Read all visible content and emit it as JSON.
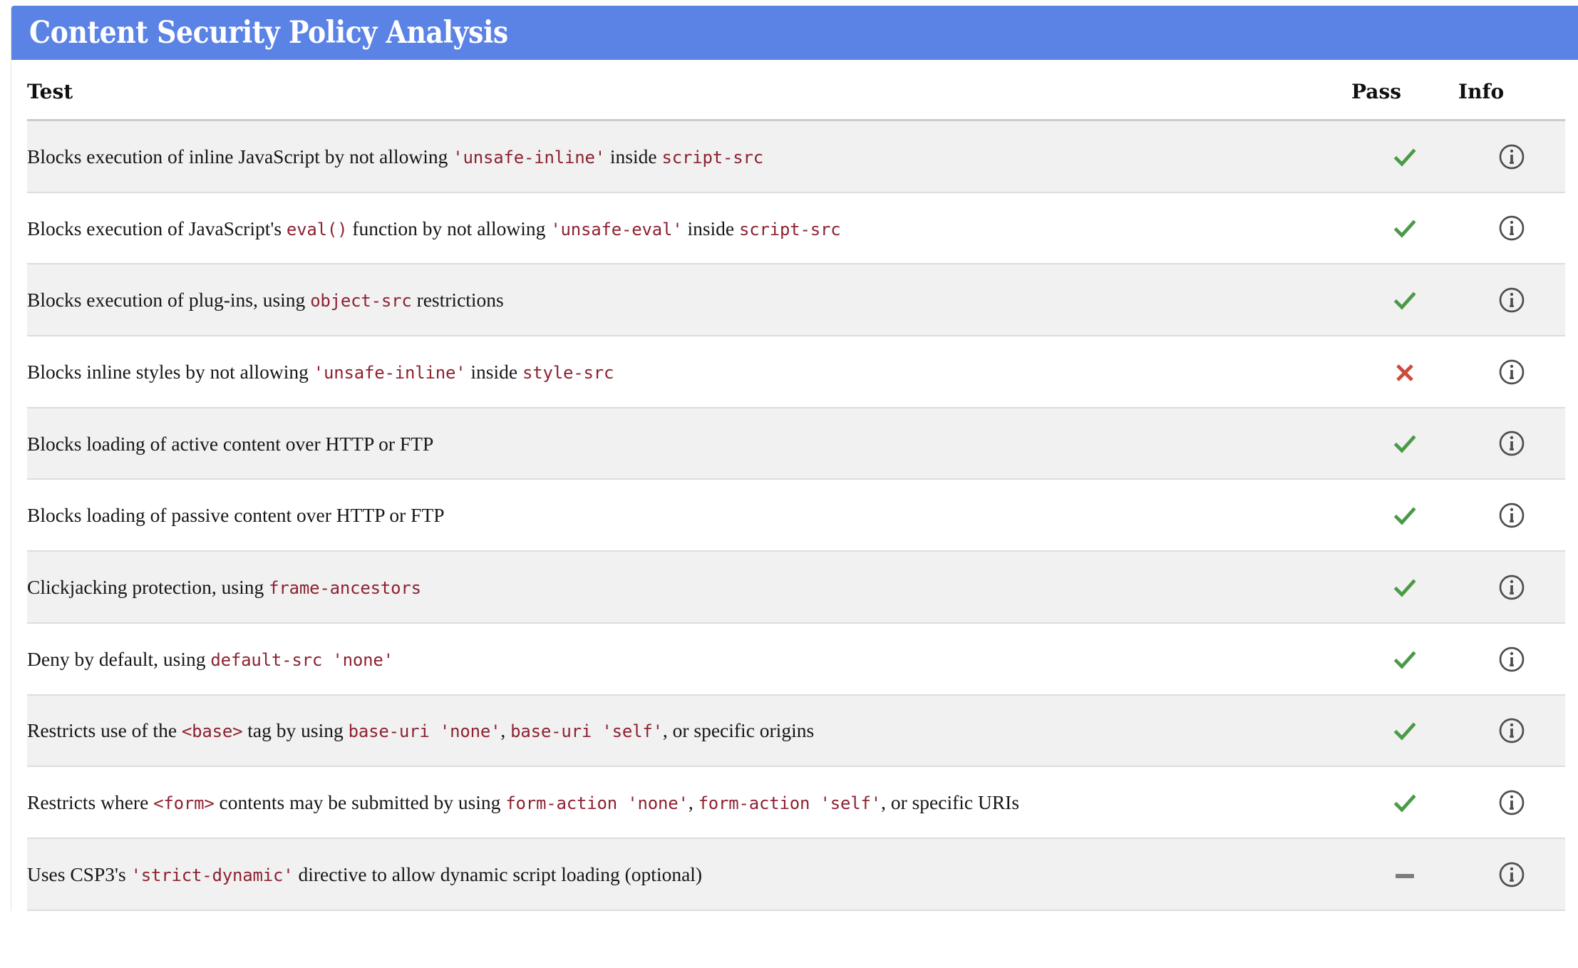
{
  "header": {
    "title": "Content Security Policy Analysis",
    "background_color": "#5b83e5",
    "text_color": "#ffffff"
  },
  "table": {
    "columns": {
      "test": "Test",
      "pass": "Pass",
      "info": "Info"
    },
    "colors": {
      "pass_green": "#4a9a48",
      "fail_red": "#cc4b3b",
      "na_gray": "#7d7d7d",
      "code_maroon": "#8d2231",
      "stripe": "#f1f1f1"
    },
    "info_icon_label": "info-icon",
    "rows": [
      {
        "id": "inline-javascript",
        "parts": [
          {
            "t": "text",
            "v": "Blocks execution of inline JavaScript by not allowing "
          },
          {
            "t": "code",
            "v": "'unsafe-inline'"
          },
          {
            "t": "text",
            "v": " inside "
          },
          {
            "t": "code",
            "v": "script-src"
          }
        ],
        "plain": "Blocks execution of inline JavaScript by not allowing 'unsafe-inline' inside script-src",
        "status": "pass"
      },
      {
        "id": "eval-function",
        "parts": [
          {
            "t": "text",
            "v": "Blocks execution of JavaScript's "
          },
          {
            "t": "code",
            "v": "eval()"
          },
          {
            "t": "text",
            "v": " function by not allowing "
          },
          {
            "t": "code",
            "v": "'unsafe-eval'"
          },
          {
            "t": "text",
            "v": " inside "
          },
          {
            "t": "code",
            "v": "script-src"
          }
        ],
        "plain": "Blocks execution of JavaScript's eval() function by not allowing 'unsafe-eval' inside script-src",
        "status": "pass"
      },
      {
        "id": "plug-ins",
        "parts": [
          {
            "t": "text",
            "v": "Blocks execution of plug-ins, using "
          },
          {
            "t": "code",
            "v": "object-src"
          },
          {
            "t": "text",
            "v": " restrictions"
          }
        ],
        "plain": "Blocks execution of plug-ins, using object-src restrictions",
        "status": "pass"
      },
      {
        "id": "inline-styles",
        "parts": [
          {
            "t": "text",
            "v": "Blocks inline styles by not allowing "
          },
          {
            "t": "code",
            "v": "'unsafe-inline'"
          },
          {
            "t": "text",
            "v": " inside "
          },
          {
            "t": "code",
            "v": "style-src"
          }
        ],
        "plain": "Blocks inline styles by not allowing 'unsafe-inline' inside style-src",
        "status": "fail"
      },
      {
        "id": "active-content",
        "parts": [
          {
            "t": "text",
            "v": "Blocks loading of active content over HTTP or FTP"
          }
        ],
        "plain": "Blocks loading of active content over HTTP or FTP",
        "status": "pass"
      },
      {
        "id": "passive-content",
        "parts": [
          {
            "t": "text",
            "v": "Blocks loading of passive content over HTTP or FTP"
          }
        ],
        "plain": "Blocks loading of passive content over HTTP or FTP",
        "status": "pass"
      },
      {
        "id": "clickjacking",
        "parts": [
          {
            "t": "text",
            "v": "Clickjacking protection, using "
          },
          {
            "t": "code",
            "v": "frame-ancestors"
          }
        ],
        "plain": "Clickjacking protection, using frame-ancestors",
        "status": "pass"
      },
      {
        "id": "deny-by-default",
        "parts": [
          {
            "t": "text",
            "v": "Deny by default, using "
          },
          {
            "t": "code",
            "v": "default-src 'none'"
          }
        ],
        "plain": "Deny by default, using default-src 'none'",
        "status": "pass"
      },
      {
        "id": "base-uri",
        "parts": [
          {
            "t": "text",
            "v": "Restricts use of the "
          },
          {
            "t": "code",
            "v": "<base>"
          },
          {
            "t": "text",
            "v": " tag by using "
          },
          {
            "t": "code",
            "v": "base-uri 'none'"
          },
          {
            "t": "text",
            "v": ", "
          },
          {
            "t": "code",
            "v": "base-uri 'self'"
          },
          {
            "t": "text",
            "v": ", or specific origins"
          }
        ],
        "plain": "Restricts use of the <base> tag by using base-uri 'none', base-uri 'self', or specific origins",
        "status": "pass"
      },
      {
        "id": "form-action",
        "parts": [
          {
            "t": "text",
            "v": "Restricts where "
          },
          {
            "t": "code",
            "v": "<form>"
          },
          {
            "t": "text",
            "v": " contents may be submitted by using "
          },
          {
            "t": "code",
            "v": "form-action 'none'"
          },
          {
            "t": "text",
            "v": ", "
          },
          {
            "t": "code",
            "v": "form-action 'self'"
          },
          {
            "t": "text",
            "v": ", or specific URIs"
          }
        ],
        "plain": "Restricts where <form> contents may be submitted by using form-action 'none', form-action 'self', or specific URIs",
        "status": "pass"
      },
      {
        "id": "strict-dynamic",
        "parts": [
          {
            "t": "text",
            "v": "Uses CSP3's "
          },
          {
            "t": "code",
            "v": "'strict-dynamic'"
          },
          {
            "t": "text",
            "v": " directive to allow dynamic script loading (optional)"
          }
        ],
        "plain": "Uses CSP3's 'strict-dynamic' directive to allow dynamic script loading (optional)",
        "status": "na"
      }
    ]
  }
}
